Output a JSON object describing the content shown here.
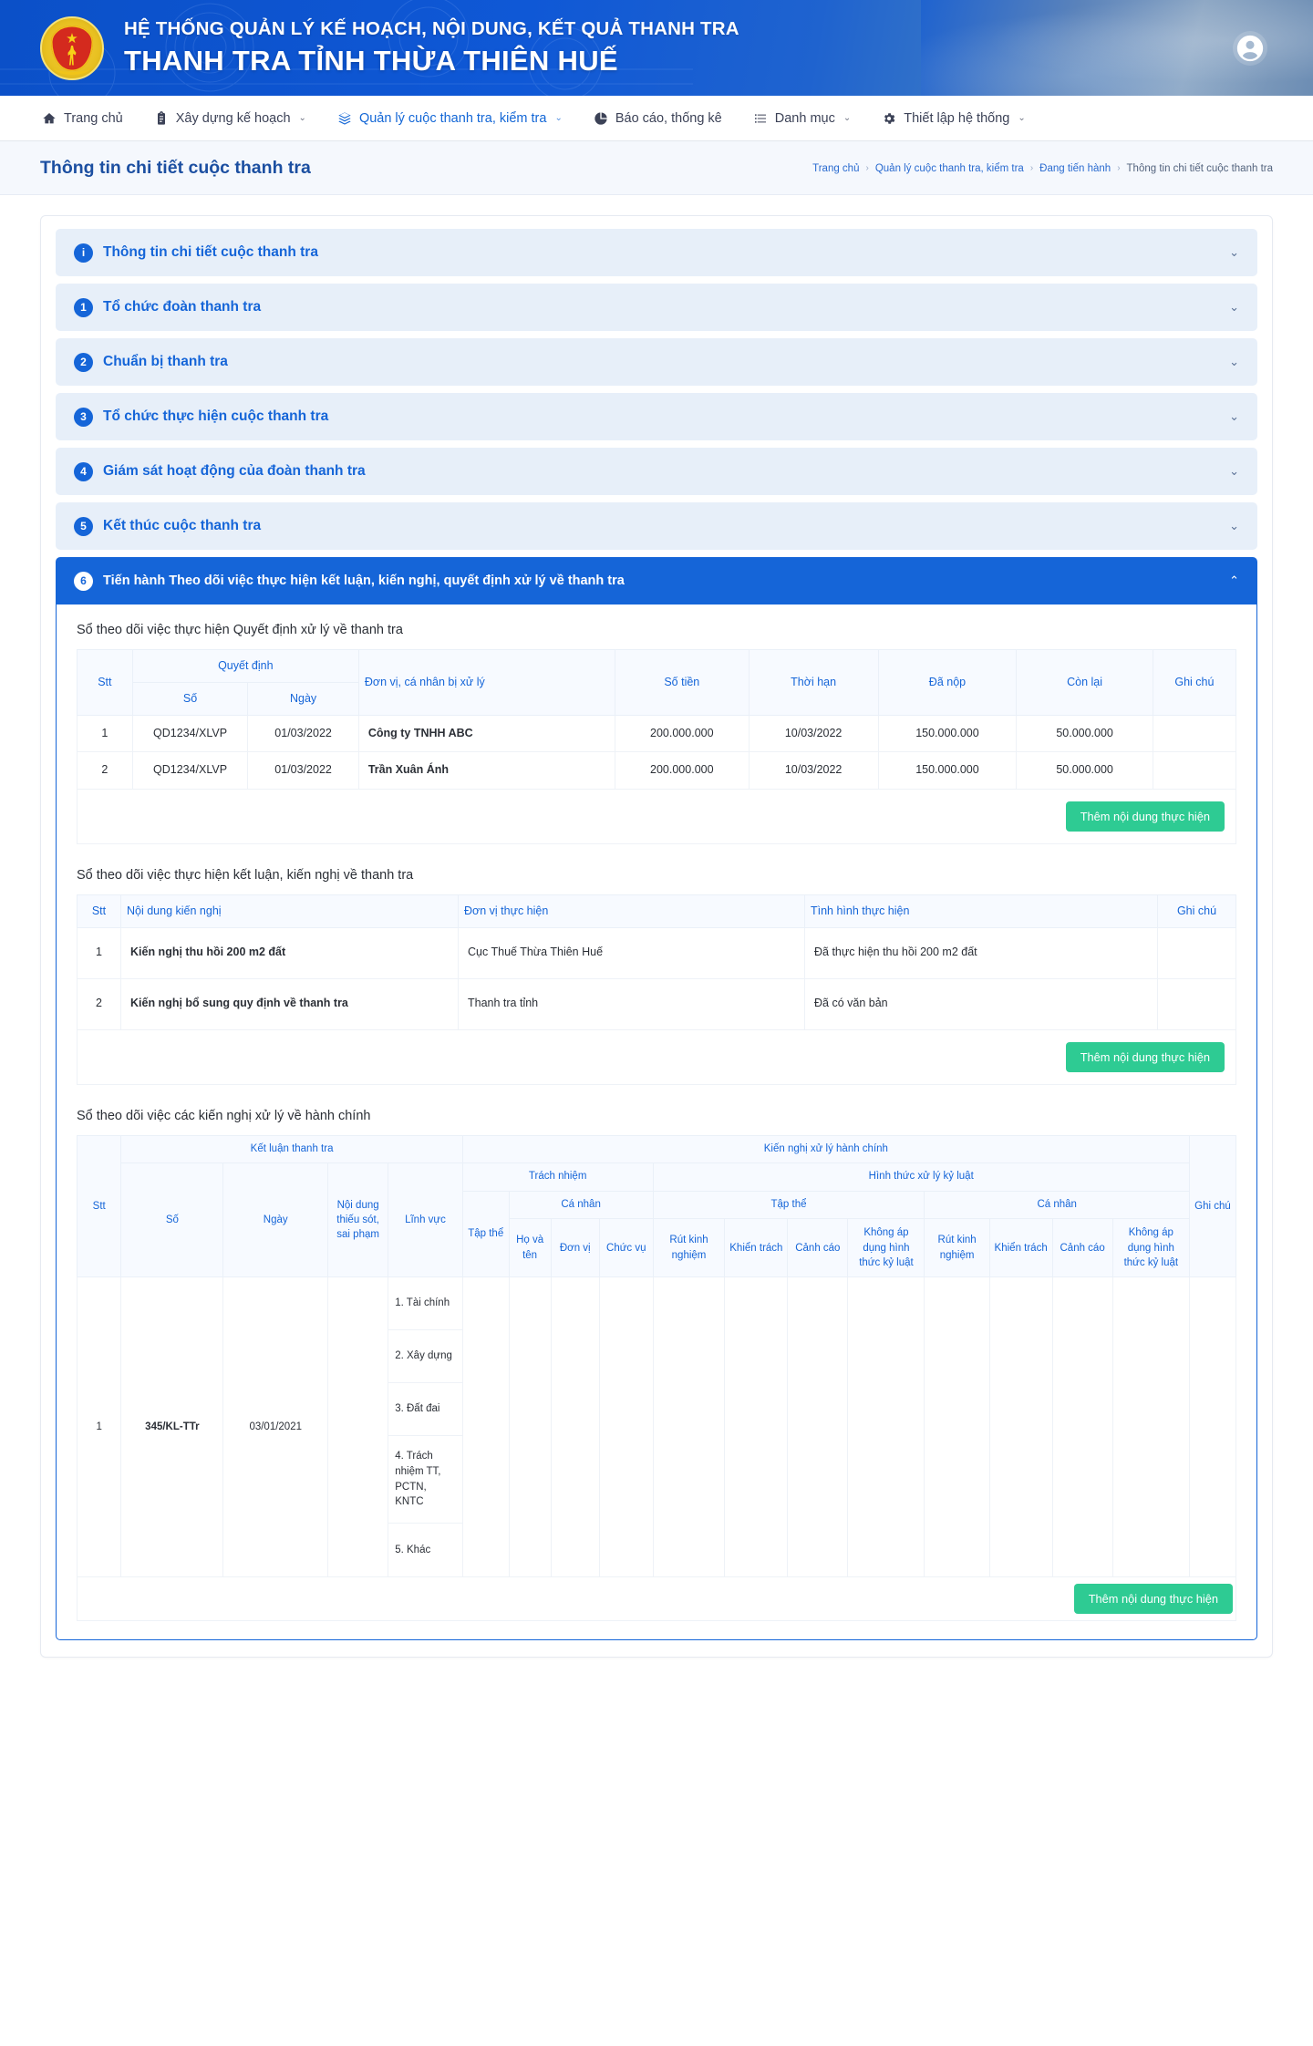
{
  "header": {
    "subtitle": "HỆ THỐNG QUẢN LÝ KẾ HOẠCH, NỘI DUNG, KẾT QUẢ THANH TRA",
    "title": "THANH TRA TỈNH THỪA THIÊN HUẾ",
    "emblem_icon": "vietnam-inspectorate-emblem",
    "avatar_icon": "user-circle-icon"
  },
  "nav": {
    "items": [
      {
        "label": "Trang chủ",
        "icon": "home-icon",
        "caret": false,
        "active": false
      },
      {
        "label": "Xây dựng kế hoạch",
        "icon": "clipboard-icon",
        "caret": true,
        "active": false
      },
      {
        "label": "Quản lý cuộc thanh tra, kiểm tra",
        "icon": "layers-icon",
        "caret": true,
        "active": true
      },
      {
        "label": "Báo cáo, thống kê",
        "icon": "pie-chart-icon",
        "caret": false,
        "active": false
      },
      {
        "label": "Danh mục",
        "icon": "list-icon",
        "caret": true,
        "active": false
      },
      {
        "label": "Thiết lập hệ thống",
        "icon": "gear-icon",
        "caret": true,
        "active": false
      }
    ]
  },
  "page": {
    "title": "Thông tin chi tiết cuộc thanh tra",
    "breadcrumb": [
      "Trang chủ",
      "Quản lý cuộc thanh tra, kiểm tra",
      "Đang tiến hành",
      "Thông tin chi tiết cuộc thanh tra"
    ]
  },
  "accordion": [
    {
      "badge": "i",
      "label": "Thông tin chi tiết cuộc thanh tra",
      "open": false,
      "chevron": "chevron-down"
    },
    {
      "badge": "1",
      "label": "Tổ chức đoàn thanh tra",
      "open": false,
      "chevron": "chevron-down"
    },
    {
      "badge": "2",
      "label": "Chuẩn bị thanh tra",
      "open": false,
      "chevron": "chevron-down"
    },
    {
      "badge": "3",
      "label": "Tổ chức thực hiện cuộc thanh tra",
      "open": false,
      "chevron": "chevron-down"
    },
    {
      "badge": "4",
      "label": "Giám sát hoạt động của đoàn thanh tra",
      "open": false,
      "chevron": "chevron-down"
    },
    {
      "badge": "5",
      "label": "Kết thúc cuộc thanh tra",
      "open": false,
      "chevron": "chevron-down"
    },
    {
      "badge": "6",
      "label": "Tiến hành Theo dõi việc thực hiện kết luận, kiến nghị, quyết định xử lý về thanh tra",
      "open": true,
      "chevron": "chevron-up"
    }
  ],
  "section_decision": {
    "title": "Sổ theo dõi việc thực hiện Quyết định xử lý về thanh tra",
    "headers": {
      "stt": "Stt",
      "quyet_dinh": "Quyết định",
      "so": "Số",
      "ngay": "Ngày",
      "don_vi": "Đơn vị, cá nhân bị xử lý",
      "so_tien": "Số tiền",
      "thoi_han": "Thời hạn",
      "da_nop": "Đã nộp",
      "con_lai": "Còn lại",
      "ghi_chu": "Ghi chú"
    },
    "rows": [
      {
        "stt": "1",
        "so": "QD1234/XLVP",
        "ngay": "01/03/2022",
        "don_vi": "Công ty TNHH ABC",
        "so_tien": "200.000.000",
        "thoi_han": "10/03/2022",
        "da_nop": "150.000.000",
        "con_lai": "50.000.000",
        "ghi_chu": ""
      },
      {
        "stt": "2",
        "so": "QD1234/XLVP",
        "ngay": "01/03/2022",
        "don_vi": "Trần Xuân Ánh",
        "so_tien": "200.000.000",
        "thoi_han": "10/03/2022",
        "da_nop": "150.000.000",
        "con_lai": "50.000.000",
        "ghi_chu": ""
      }
    ],
    "add_button": "Thêm nội dung thực hiện"
  },
  "section_conclusion": {
    "title": "Sổ theo dõi việc thực hiện kết luận, kiến nghị về thanh tra",
    "headers": {
      "stt": "Stt",
      "noi_dung": "Nội dung kiến nghị",
      "don_vi": "Đơn vị thực hiện",
      "tinh_hinh": "Tình hình thực hiện",
      "ghi_chu": "Ghi chú"
    },
    "rows": [
      {
        "stt": "1",
        "noi_dung": "Kiến nghị thu hồi 200 m2 đất",
        "don_vi": "Cục Thuế Thừa Thiên Huế",
        "tinh_hinh": "Đã thực hiện thu hồi 200 m2 đất",
        "ghi_chu": ""
      },
      {
        "stt": "2",
        "noi_dung": "Kiến nghị bổ sung quy định về thanh tra",
        "don_vi": "Thanh tra tỉnh",
        "tinh_hinh": "Đã có văn bản",
        "ghi_chu": ""
      }
    ],
    "add_button": "Thêm nội dung thực hiện"
  },
  "section_admin": {
    "title": "Sổ theo dõi việc các kiến nghị xử lý về hành chính",
    "headers": {
      "stt": "Stt",
      "ket_luan_thanh_tra": "Kết luận thanh tra",
      "kien_nghi_xu_ly": "Kiến nghị xử lý hành chính",
      "trach_nhiem": "Trách nhiệm",
      "hinh_thuc_xu_ly": "Hình thức xử lý kỷ luật",
      "ca_nhan": "Cá nhân",
      "tap_the": "Tập thể",
      "so": "Số",
      "ngay": "Ngày",
      "noi_dung_thieu_sot": "Nội dung thiếu sót, sai phạm",
      "linh_vuc": "Lĩnh vực",
      "tap_the_col": "Tập thể",
      "ho_va_ten": "Họ và tên",
      "don_vi": "Đơn vị",
      "chuc_vu": "Chức vụ",
      "rut_kinh_nghiem": "Rút kinh nghiệm",
      "khien_trach": "Khiển trách",
      "canh_cao": "Cảnh cáo",
      "khong_ap_dung": "Không áp dụng hình thức kỷ luật",
      "ghi_chu": "Ghi chú"
    },
    "rows": [
      {
        "stt": "1",
        "so": "345/KL-TTr",
        "ngay": "03/01/2021",
        "noi_dung_thieu_sot": "",
        "linh_vuc": [
          "1. Tài chính",
          "2. Xây dựng",
          " 3. Đất đai",
          "4. Trách nhiệm TT, PCTN, KNTC",
          "5. Khác"
        ],
        "tap_the": "",
        "ho_va_ten": "",
        "don_vi": "",
        "chuc_vu": "",
        "tt_rut_kinh_nghiem": "",
        "tt_khien_trach": "",
        "tt_canh_cao": "",
        "tt_khong_ap_dung": "",
        "cn_rut_kinh_nghiem": "",
        "cn_khien_trach": "",
        "cn_canh_cao": "",
        "cn_khong_ap_dung": "",
        "ghi_chu": ""
      }
    ],
    "add_button": "Thêm nội dung thực hiện"
  },
  "colors": {
    "brand_blue": "#1565d8",
    "banner_blue": "#0f58d6",
    "green_amount": "#2bb673",
    "red_deadline": "#e8402a",
    "blue_paid": "#3aa0e8",
    "orange_remaining": "#f0a020",
    "button_green": "#2ecb93"
  }
}
